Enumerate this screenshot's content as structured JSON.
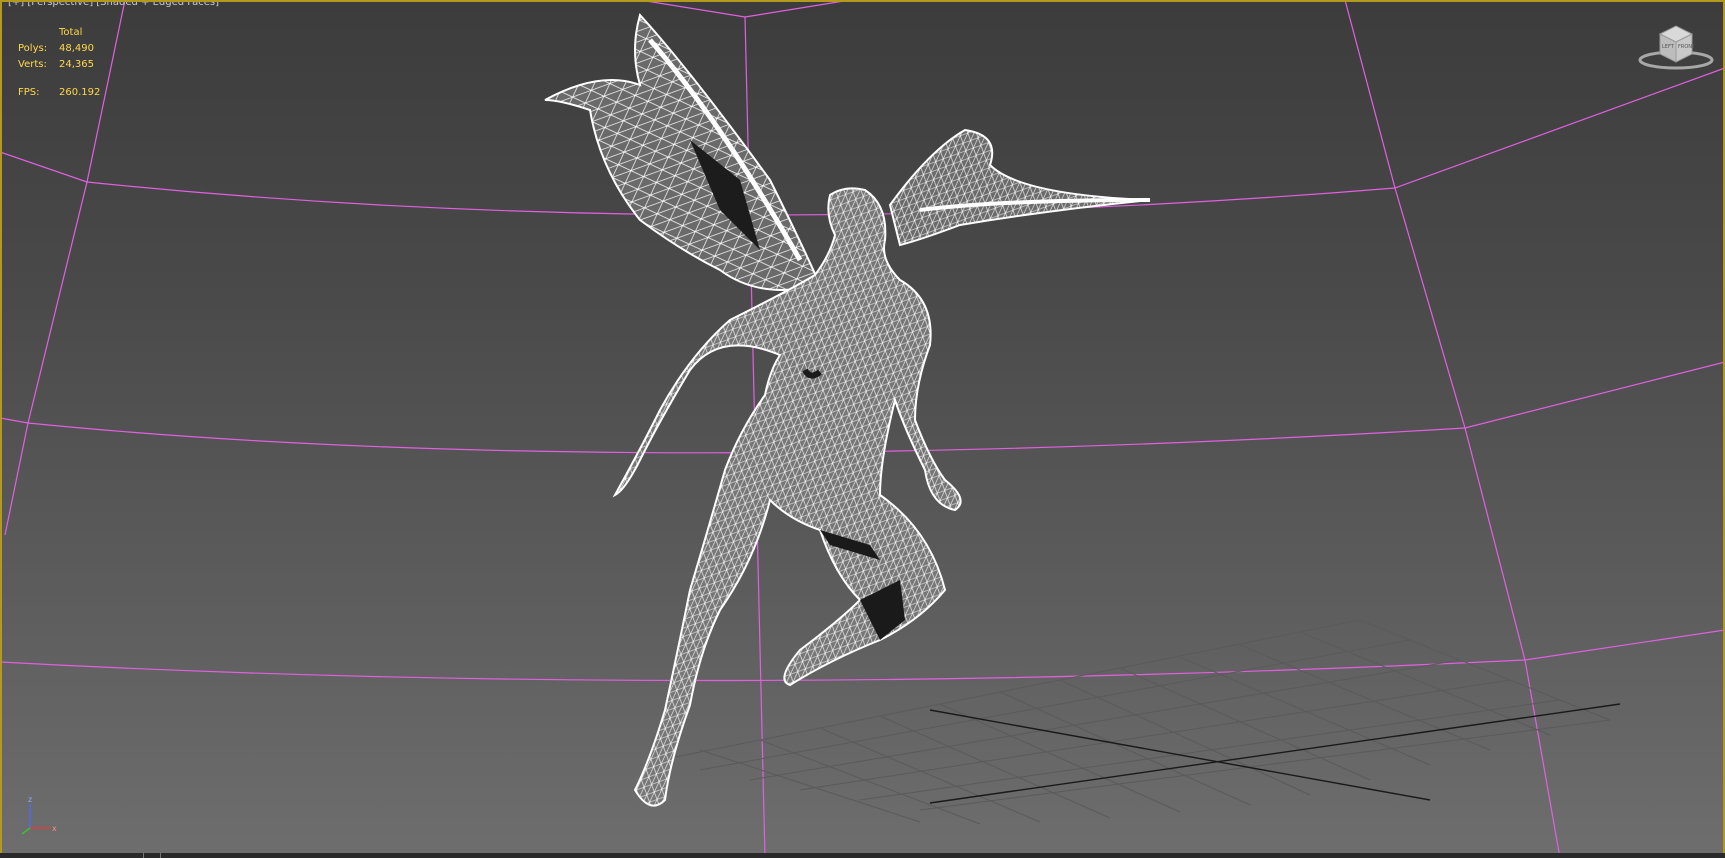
{
  "viewport": {
    "menu": "[+]",
    "view": "[Perspective]",
    "shading": "[Shaded + Edged Faces]"
  },
  "stats": {
    "header": "Total",
    "polys_label": "Polys:",
    "polys_value": "48,490",
    "verts_label": "Verts:",
    "verts_value": "24,365",
    "fps_label": "FPS:",
    "fps_value": "260.192"
  },
  "viewcube": {
    "left_face": "LEFT",
    "front_face": "FRONT"
  },
  "axis_tripod": {
    "z": "z",
    "x": "x"
  },
  "colors": {
    "grid_lines": "#e061e0",
    "stats_text": "#ffd84a",
    "viewport_border": "#b39a1f",
    "wireframe": "#ffffff"
  }
}
